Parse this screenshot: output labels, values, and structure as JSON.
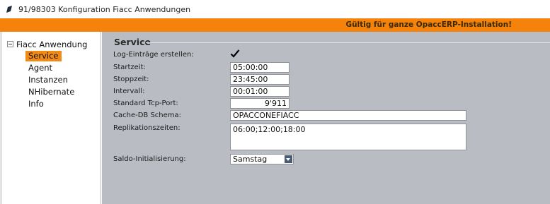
{
  "window": {
    "title": "91/98303 Konfiguration Fiacc Anwendungen"
  },
  "banner": {
    "text": "Gültig für ganze OpaccERP-Installation!",
    "color": "#f5820a"
  },
  "nav": {
    "root_label": "Fiacc Anwendung",
    "items": [
      {
        "label": "Service",
        "selected": true
      },
      {
        "label": "Agent",
        "selected": false
      },
      {
        "label": "Instanzen",
        "selected": false
      },
      {
        "label": "NHibernate",
        "selected": false
      },
      {
        "label": "Info",
        "selected": false
      }
    ]
  },
  "section": {
    "title": "Service"
  },
  "form": {
    "log_label": "Log-Einträge erstellen:",
    "log_checked": true,
    "start_label": "Startzeit:",
    "start_value": "05:00:00",
    "stop_label": "Stoppzeit:",
    "stop_value": "23:45:00",
    "interval_label": "Intervall:",
    "interval_value": "00:01:00",
    "port_label": "Standard Tcp-Port:",
    "port_value": "9'911",
    "schema_label": "Cache-DB Schema:",
    "schema_value": "OPACCONEFIACC",
    "replication_label": "Replikationszeiten:",
    "replication_value": "06:00;12:00;18:00",
    "saldo_label": "Saldo-Initialisierung:",
    "saldo_value": "Samstag"
  }
}
